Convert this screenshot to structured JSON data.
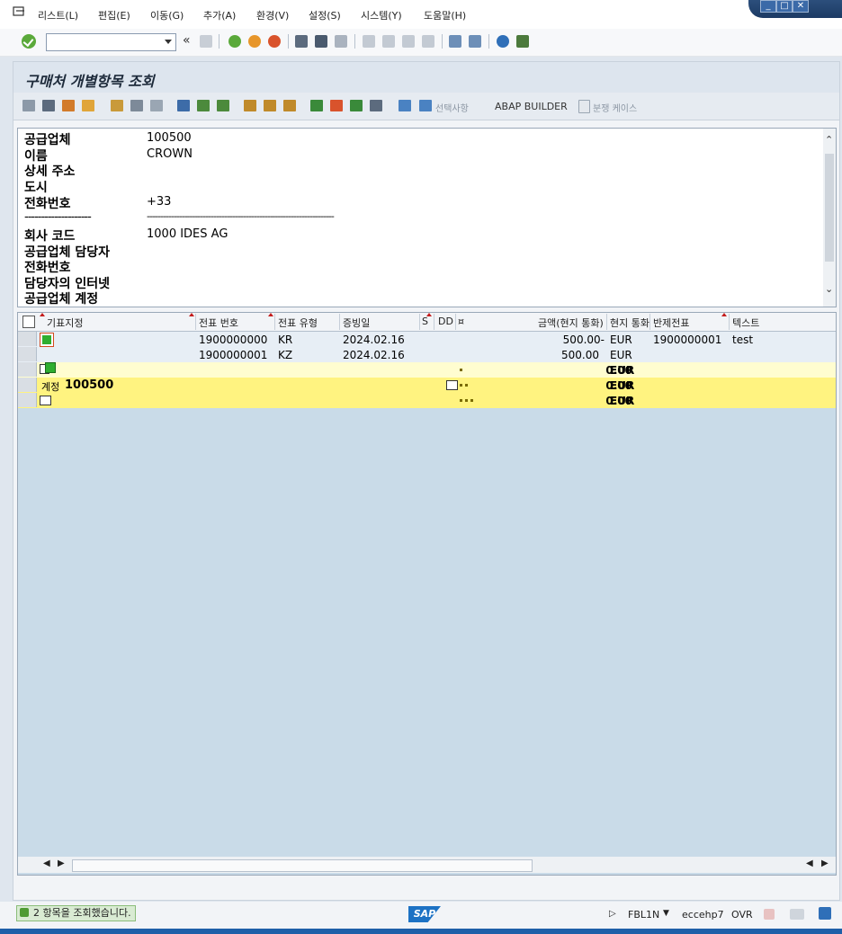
{
  "menubar": {
    "items": [
      "리스트(L)",
      "편집(E)",
      "이동(G)",
      "추가(A)",
      "환경(V)",
      "설정(S)",
      "시스템(Y)",
      "도움말(H)"
    ]
  },
  "window_controls": {
    "minimize": "_",
    "maximize": "□",
    "close": "✕"
  },
  "std_toolbar": {
    "command_value": "",
    "history_glyph": "«"
  },
  "page": {
    "title": "구매처 개별항목 조회"
  },
  "app_toolbar": {
    "selection_label": "선택사항",
    "abap_builder_label": "ABAP BUILDER",
    "dispute_case_label": "분쟁 케이스"
  },
  "header_fields": [
    {
      "label": "공급업체",
      "value": "100500"
    },
    {
      "label": "이름",
      "value": "CROWN"
    },
    {
      "label": "상세 주소",
      "value": ""
    },
    {
      "label": "도시",
      "value": ""
    },
    {
      "label": "전화번호",
      "value": "+33"
    },
    {
      "label": "--------------------",
      "value": "----------------------------------------------------------------------"
    },
    {
      "label": "회사 코드",
      "value": "1000 IDES AG"
    },
    {
      "label": "공급업체 담당자",
      "value": ""
    },
    {
      "label": "전화번호",
      "value": ""
    },
    {
      "label": "담당자의 인터넷",
      "value": ""
    },
    {
      "label": "공급업체 계정",
      "value": ""
    }
  ],
  "grid": {
    "columns": [
      "기표지정",
      "전표 번호",
      "전표 유형",
      "증빙일",
      "S",
      "DD",
      "¤",
      "금액(현지 통화)",
      "현지 통화",
      "반제전표",
      "텍스트"
    ],
    "rows": [
      {
        "doc_no": "1900000000",
        "doc_type": "KR",
        "doc_date": "2024.02.16",
        "amount": "500.00-",
        "currency": "EUR",
        "clearing_doc": "1900000001",
        "text": "test"
      },
      {
        "doc_no": "1900000001",
        "doc_type": "KZ",
        "doc_date": "2024.02.16",
        "amount": "500.00",
        "currency": "EUR",
        "clearing_doc": "",
        "text": ""
      }
    ],
    "subtotal": {
      "amount": "0.00",
      "currency": "EUR"
    },
    "account_total": {
      "label": "계정",
      "account": "100500",
      "amount": "0.00",
      "currency": "EUR"
    },
    "grand_total": {
      "amount": "0.00",
      "currency": "EUR"
    }
  },
  "statusbar": {
    "message": "2 항목을 조회했습니다.",
    "logo": "SAP",
    "transaction": "FBL1N",
    "server": "eccehp7",
    "mode": "OVR"
  },
  "colors": {
    "accent": "#1e5fa8",
    "total_row": "#fff380",
    "subtotal_row": "#fffdd0",
    "grid_bg": "#c9dbe8"
  }
}
